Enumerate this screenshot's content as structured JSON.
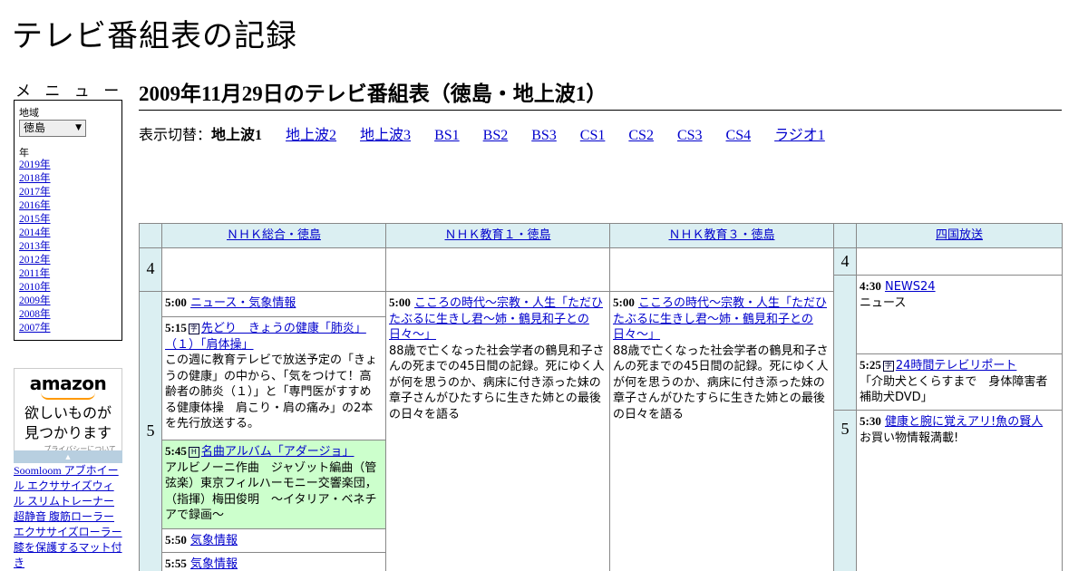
{
  "site": {
    "title": "テレビ番組表の記録"
  },
  "menu": {
    "heading": "メ ニ ュ ー",
    "region_label": "地域",
    "region_value": "徳島",
    "year_label": "年",
    "years": [
      "2019年",
      "2018年",
      "2017年",
      "2016年",
      "2015年",
      "2014年",
      "2013年",
      "2012年",
      "2011年",
      "2010年",
      "2009年",
      "2008年",
      "2007年"
    ]
  },
  "ad": {
    "logo": "amazon",
    "tagline_1": "欲しいものが",
    "tagline_2": "見つかります",
    "privacy": "プライバシーについて",
    "link_text": "Soomloom アブホイール エクササイズウィル スリムトレーナー 超静音 腹筋ローラー エクササイズローラー 膝を保護するマット付き"
  },
  "page": {
    "heading": "2009年11月29日のテレビ番組表（徳島・地上波1）",
    "switch_label": "表示切替：",
    "switch_current": "地上波1",
    "switch_links": [
      "地上波2",
      "地上波3",
      "BS1",
      "BS2",
      "BS3",
      "CS1",
      "CS2",
      "CS3",
      "CS4",
      "ラジオ1"
    ]
  },
  "schedule": {
    "channels": [
      "ＮＨＫ総合・徳島",
      "ＮＨＫ教育１・徳島",
      "ＮＨＫ教育３・徳島",
      "四国放送"
    ],
    "hours": [
      "4",
      "5"
    ],
    "nhk_sogo": [
      {
        "time": "5:00",
        "title": "ニュース・気象情報",
        "desc": ""
      },
      {
        "time": "5:15",
        "title": "先どり　きょうの健康「肺炎」（１）「肩体操」",
        "desc": "この週に教育テレビで放送予定の「きょうの健康」の中から、「気をつけて！高齢者の肺炎（１）」と「専門医がすすめる健康体操　肩こり・肩の痛み」の2本を先行放送する。"
      },
      {
        "time": "5:45",
        "title": "名曲アルバム「アダージョ」",
        "desc": "アルビノーニ作曲　ジャゾット編曲（管弦楽）東京フィルハーモニー交響楽団，（指揮）梅田俊明　～イタリア・ベネチアで録画～"
      },
      {
        "time": "5:50",
        "title": "気象情報",
        "desc": ""
      },
      {
        "time": "5:55",
        "title": "気象情報",
        "desc": ""
      }
    ],
    "nhk_kyoiku1": [
      {
        "time": "5:00",
        "title": "こころの時代～宗教・人生「ただひたぶるに生きし君～姉・鶴見和子との日々～」",
        "desc": "88歳で亡くなった社会学者の鶴見和子さんの死までの45日間の記録。死にゆく人が何を思うのか、病床に付き添った妹の章子さんがひたすらに生きた姉との最後の日々を語る"
      }
    ],
    "nhk_kyoiku3": [
      {
        "time": "5:00",
        "title": "こころの時代～宗教・人生「ただひたぶるに生きし君～姉・鶴見和子との日々～」",
        "desc": "88歳で亡くなった社会学者の鶴見和子さんの死までの45日間の記録。死にゆく人が何を思うのか、病床に付き添った妹の章子さんがひたすらに生きた姉との最後の日々を語る"
      }
    ],
    "shikoku": [
      {
        "time": "4:30",
        "title": "NEWS24",
        "desc": "ニュース"
      },
      {
        "time": "5:25",
        "title": "24時間テレビリポート",
        "desc": "「介助犬とくらすまで　身体障害者補助犬DVD」"
      },
      {
        "time": "5:30",
        "title": "健康と腕に覚えアリ!魚の賢人",
        "desc": "お買い物情報満載!"
      }
    ],
    "colors": {
      "header_bg": "#dbeff2",
      "highlight": "#ccffcc",
      "link": "#0000cc"
    }
  }
}
